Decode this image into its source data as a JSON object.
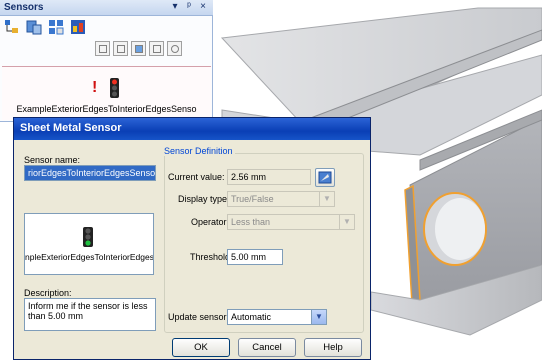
{
  "sensors_panel": {
    "title": "Sensors",
    "title_controls": [
      "▾",
      "ᵖ",
      "×"
    ],
    "list_item_label": "ExampleExteriorEdgesToInteriorEdgesSenso"
  },
  "dialog": {
    "title": "Sheet Metal Sensor",
    "sensor_name_label": "Sensor name:",
    "sensor_name_value": "riorEdgesToInteriorEdgesSensor",
    "image_caption": "npleExteriorEdgesToInteriorEdges",
    "description_label": "Description:",
    "description_value": "Inform me if the sensor is less than 5.00 mm",
    "sensor_definition_legend": "Sensor Definition",
    "current_value_label": "Current value:",
    "current_value": "2.56 mm",
    "display_type_label": "Display type:",
    "display_type_value": "True/False",
    "operator_label": "Operator:",
    "operator_value": "Less than",
    "threshold_label": "Threshold:",
    "threshold_value": "5.00 mm",
    "update_sensor_label": "Update sensor:",
    "update_sensor_value": "Automatic",
    "ok_label": "OK",
    "cancel_label": "Cancel",
    "help_label": "Help"
  },
  "colors": {
    "dialog_title_bar": "#0a3fb5",
    "selection": "#316ac5",
    "warning": "#d01010",
    "highlight_edge": "#f0a030"
  }
}
